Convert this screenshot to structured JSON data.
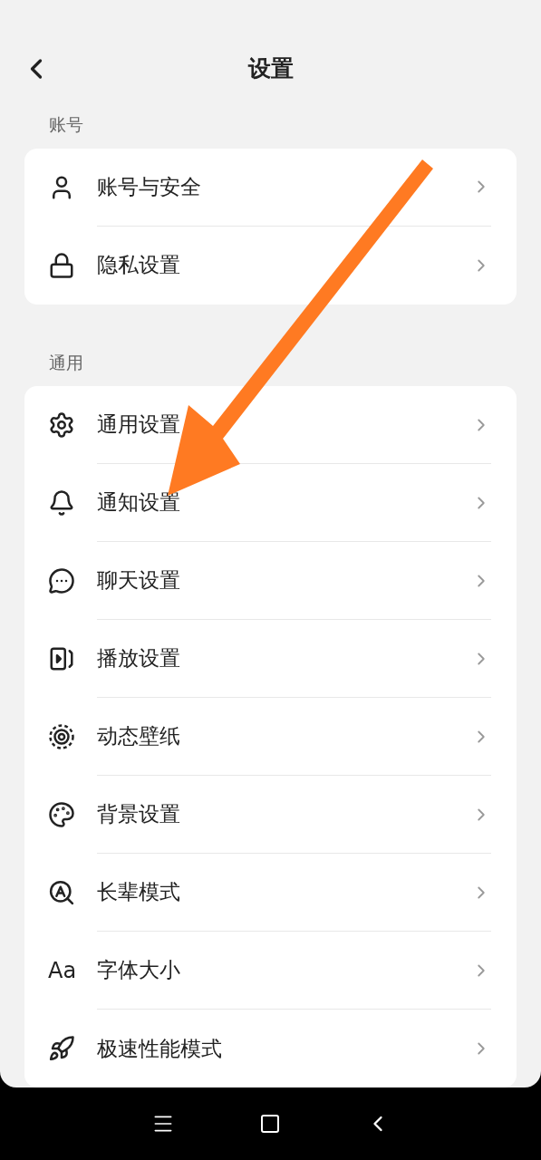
{
  "header": {
    "title": "设置"
  },
  "sections": [
    {
      "label": "账号",
      "items": [
        {
          "label": "账号与安全"
        },
        {
          "label": "隐私设置"
        }
      ]
    },
    {
      "label": "通用",
      "items": [
        {
          "label": "通用设置"
        },
        {
          "label": "通知设置"
        },
        {
          "label": "聊天设置"
        },
        {
          "label": "播放设置"
        },
        {
          "label": "动态壁纸"
        },
        {
          "label": "背景设置"
        },
        {
          "label": "长辈模式"
        },
        {
          "label": "字体大小",
          "glyph": "Aa"
        },
        {
          "label": "极速性能模式"
        }
      ]
    }
  ]
}
